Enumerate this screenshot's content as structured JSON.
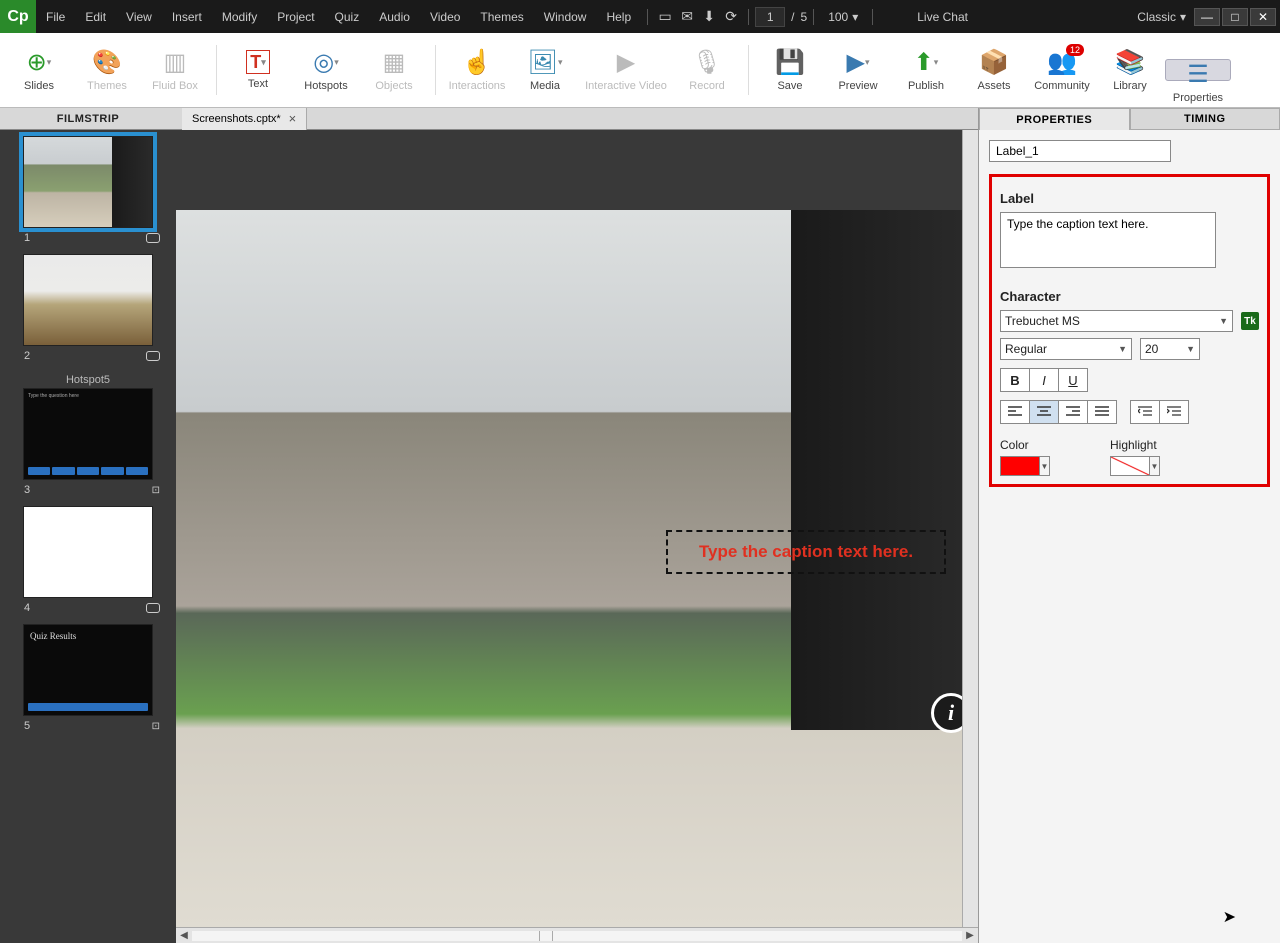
{
  "menu": [
    "File",
    "Edit",
    "View",
    "Insert",
    "Modify",
    "Project",
    "Quiz",
    "Audio",
    "Video",
    "Themes",
    "Window",
    "Help"
  ],
  "page": {
    "current": "1",
    "total": "5"
  },
  "zoom": "100",
  "live_chat": "Live Chat",
  "workspace": "Classic",
  "toolbar": {
    "slides": "Slides",
    "themes": "Themes",
    "fluidbox": "Fluid Box",
    "text": "Text",
    "hotspots": "Hotspots",
    "objects": "Objects",
    "interactions": "Interactions",
    "media": "Media",
    "ivideo": "Interactive Video",
    "record": "Record",
    "save": "Save",
    "preview": "Preview",
    "publish": "Publish",
    "assets": "Assets",
    "community": "Community",
    "library": "Library",
    "properties": "Properties",
    "badge": "12"
  },
  "filmstrip": {
    "header": "FILMSTRIP",
    "slides": [
      {
        "num": "1"
      },
      {
        "num": "2"
      },
      {
        "num": "3",
        "title": "Hotspot5"
      },
      {
        "num": "4"
      },
      {
        "num": "5"
      }
    ]
  },
  "doc_tab": "Screenshots.cptx*",
  "caption_text": "Type the caption text here.",
  "props": {
    "tabs": [
      "PROPERTIES",
      "TIMING"
    ],
    "name": "Label_1",
    "label_section": "Label",
    "label_text": "Type the caption text here.",
    "character_section": "Character",
    "font": "Trebuchet MS",
    "weight": "Regular",
    "size": "20",
    "bold": "B",
    "italic": "I",
    "underline": "U",
    "color_label": "Color",
    "highlight_label": "Highlight",
    "color": "#ff0000"
  }
}
